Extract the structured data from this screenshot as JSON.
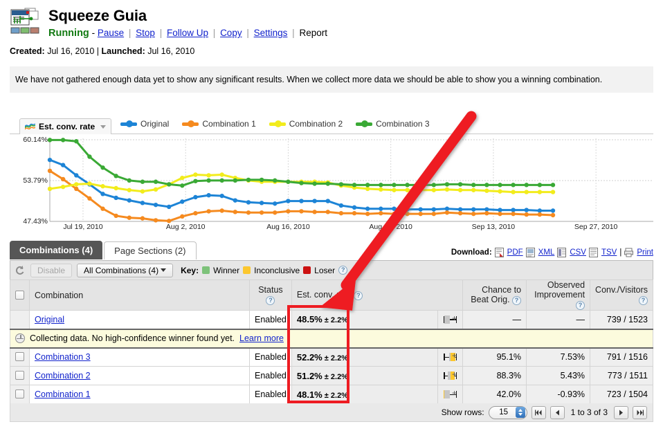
{
  "header": {
    "icon": "experiment-icon",
    "title": "Squeeze Guia",
    "status": "Running",
    "status_dash": "-",
    "actions": [
      {
        "label": "Pause",
        "link": true
      },
      {
        "label": "Stop",
        "link": true
      },
      {
        "label": "Follow Up",
        "link": true
      },
      {
        "label": "Copy",
        "link": true
      },
      {
        "label": "Settings",
        "link": true
      },
      {
        "label": "Report",
        "link": false
      }
    ],
    "separator": "|",
    "created_label": "Created:",
    "created_value": "Jul 16, 2010",
    "launched_label": "Launched:",
    "launched_value": "Jul 16, 2010",
    "dates_sep": "|"
  },
  "notice": {
    "text": "We have not gathered enough data yet to show any significant results. When we collect more data we should be able to show you a winning combination."
  },
  "chart_controls": {
    "metric_label": "Est. conv. rate",
    "metric_icon": "sparkline-icon",
    "caret_icon": "chevron-down-icon"
  },
  "chart_data": {
    "type": "line",
    "title": "Est. conv. rate",
    "xlabel": "",
    "ylabel": "",
    "grid": true,
    "legend_position": "top",
    "ylim": [
      47.43,
      60.14
    ],
    "ytick_labels": [
      "60.14%",
      "53.79%",
      "47.43%"
    ],
    "ytick_values": [
      60.14,
      53.79,
      47.43
    ],
    "xtick_labels": [
      "Jul 19, 2010",
      "Aug 2, 2010",
      "Aug 16, 2010",
      "Aug 30, 2010",
      "Sep 13, 2010",
      "Sep 27, 2010"
    ],
    "xtick_positions": [
      0.055,
      0.225,
      0.395,
      0.565,
      0.735,
      0.905
    ],
    "series": [
      {
        "name": "Original",
        "color": "#1d84d6",
        "values": [
          57.0,
          56.2,
          54.6,
          53.2,
          51.7,
          51.1,
          50.7,
          50.3,
          50.0,
          49.7,
          50.5,
          51.2,
          51.5,
          51.4,
          50.7,
          50.4,
          50.3,
          50.2,
          50.6,
          50.6,
          50.6,
          50.6,
          49.9,
          49.6,
          49.4,
          49.4,
          49.4,
          49.3,
          49.3,
          49.3,
          49.4,
          49.3,
          49.3,
          49.3,
          49.2,
          49.2,
          49.2,
          49.1,
          49.1
        ]
      },
      {
        "name": "Combination 1",
        "color": "#f58a1f",
        "values": [
          55.3,
          54.0,
          52.5,
          51.0,
          49.4,
          48.3,
          48.0,
          47.9,
          47.6,
          47.5,
          48.2,
          48.7,
          49.0,
          49.1,
          48.9,
          48.8,
          48.8,
          48.8,
          49.0,
          49.0,
          48.9,
          48.9,
          48.7,
          48.7,
          48.6,
          48.7,
          48.6,
          48.6,
          48.6,
          48.6,
          48.8,
          48.7,
          48.6,
          48.7,
          48.6,
          48.6,
          48.5,
          48.5,
          48.4
        ]
      },
      {
        "name": "Combination 2",
        "color": "#f2ec1c",
        "values": [
          52.5,
          52.8,
          53.2,
          53.3,
          52.9,
          52.6,
          52.3,
          52.1,
          52.4,
          53.2,
          54.2,
          54.7,
          54.6,
          54.7,
          54.2,
          53.8,
          53.6,
          53.6,
          53.6,
          53.6,
          53.6,
          53.5,
          53.0,
          52.7,
          52.5,
          52.4,
          52.3,
          52.3,
          52.3,
          52.3,
          52.4,
          52.3,
          52.3,
          52.2,
          52.1,
          52.0,
          52.0,
          52.0,
          52.0
        ]
      },
      {
        "name": "Combination 3",
        "color": "#3aa935",
        "values": [
          60.1,
          60.1,
          59.9,
          57.5,
          55.8,
          54.5,
          53.8,
          53.6,
          53.6,
          53.2,
          53.0,
          53.7,
          53.8,
          53.8,
          53.8,
          53.9,
          53.9,
          53.8,
          53.6,
          53.4,
          53.3,
          53.3,
          53.2,
          53.1,
          53.1,
          53.1,
          53.1,
          53.1,
          53.1,
          53.1,
          53.2,
          53.2,
          53.1,
          53.1,
          53.1,
          53.1,
          53.1,
          53.1,
          53.1
        ]
      }
    ]
  },
  "tabs": [
    {
      "label": "Combinations (4)",
      "active": true
    },
    {
      "label": "Page Sections (2)",
      "active": false
    }
  ],
  "download": {
    "label": "Download:",
    "items": [
      {
        "label": "PDF",
        "icon": "pdf-icon"
      },
      {
        "label": "XML",
        "icon": "xml-icon"
      },
      {
        "label": "CSV",
        "icon": "csv-icon"
      },
      {
        "label": "TSV",
        "icon": "tsv-icon"
      }
    ],
    "separator": "|",
    "print": {
      "label": "Print",
      "icon": "printer-icon"
    }
  },
  "toolbar": {
    "refresh_icon": "refresh-icon",
    "disable_label": "Disable",
    "filter_label": "All Combinations (4)",
    "filter_caret": "chevron-down-icon",
    "key_label": "Key:",
    "key_items": [
      {
        "label": "Winner",
        "color": "#7dc27a"
      },
      {
        "label": "Inconclusive",
        "color": "#fcc72e"
      },
      {
        "label": "Loser",
        "color": "#cc1111"
      }
    ],
    "help_icon": "help-icon"
  },
  "table": {
    "columns": [
      {
        "key": "checkbox",
        "label": "",
        "align": "center"
      },
      {
        "key": "combination",
        "label": "Combination",
        "align": "left"
      },
      {
        "key": "status",
        "label": "Status",
        "align": "center",
        "help": true
      },
      {
        "key": "est_conv",
        "label": "Est. conv. rate",
        "align": "left",
        "help": true
      },
      {
        "key": "ci",
        "label": "",
        "align": "left"
      },
      {
        "key": "chance",
        "label": "Chance to Beat Orig.",
        "align": "right",
        "help": true
      },
      {
        "key": "observed",
        "label": "Observed Improvement",
        "align": "right",
        "help": true
      },
      {
        "key": "conv_visitors",
        "label": "Conv./Visitors",
        "align": "right",
        "help": true
      }
    ],
    "rows": [
      {
        "name": "Original",
        "is_original": true,
        "status": "Enabled",
        "est_conv": "48.5%",
        "margin": "± 2.2%",
        "chance": "—",
        "observed": "—",
        "conv_visitors": "739 / 1523",
        "ci": {
          "low": 0.05,
          "high": 0.88,
          "box_start": 0.08,
          "box_end": 0.46,
          "box_color": "#c6c6c6",
          "fill_start": 0.0,
          "fill_end": 0.0,
          "fill_color": "#fcc72e"
        }
      },
      {
        "name": "Combination 3",
        "is_original": false,
        "status": "Enabled",
        "est_conv": "52.2%",
        "margin": "± 2.2%",
        "chance": "95.1%",
        "observed": "7.53%",
        "conv_visitors": "791 / 1516",
        "ci": {
          "low": 0.05,
          "high": 0.88,
          "box_start": 0.44,
          "box_end": 0.875,
          "box_color": "#c6c6c6",
          "fill_start": 0.51,
          "fill_end": 0.875,
          "fill_color": "#fcc72e"
        }
      },
      {
        "name": "Combination 2",
        "is_original": false,
        "status": "Enabled",
        "est_conv": "51.2%",
        "margin": "± 2.2%",
        "chance": "88.3%",
        "observed": "5.43%",
        "conv_visitors": "773 / 1511",
        "ci": {
          "low": 0.05,
          "high": 0.88,
          "box_start": 0.335,
          "box_end": 0.785,
          "box_color": "#c6c6c6",
          "fill_start": 0.51,
          "fill_end": 0.785,
          "fill_color": "#fcc72e"
        }
      },
      {
        "name": "Combination 1",
        "is_original": false,
        "status": "Enabled",
        "est_conv": "48.1%",
        "margin": "± 2.2%",
        "chance": "42.0%",
        "observed": "-0.93%",
        "conv_visitors": "723 / 1504",
        "ci": {
          "low": 0.03,
          "high": 0.88,
          "box_start": 0.03,
          "box_end": 0.45,
          "box_color": "#c6c6c6",
          "fill_start": 0.03,
          "fill_end": 0.085,
          "fill_color": "#fcc72e"
        }
      }
    ],
    "inline_notice": {
      "icon": "clock-icon",
      "text": "Collecting data. No high-confidence winner found yet.",
      "link_label": "Learn more"
    },
    "ci_plus_label": "+"
  },
  "footer": {
    "show_rows_label": "Show rows:",
    "show_rows_value": "15",
    "first_icon": "first-page-icon",
    "prev_icon": "prev-page-icon",
    "range_label": "1 to 3 of 3",
    "next_icon": "next-page-icon",
    "last_icon": "last-page-icon"
  },
  "annotations": {
    "arrow_color": "#ee1c22",
    "rect_color": "#ee1c22"
  }
}
